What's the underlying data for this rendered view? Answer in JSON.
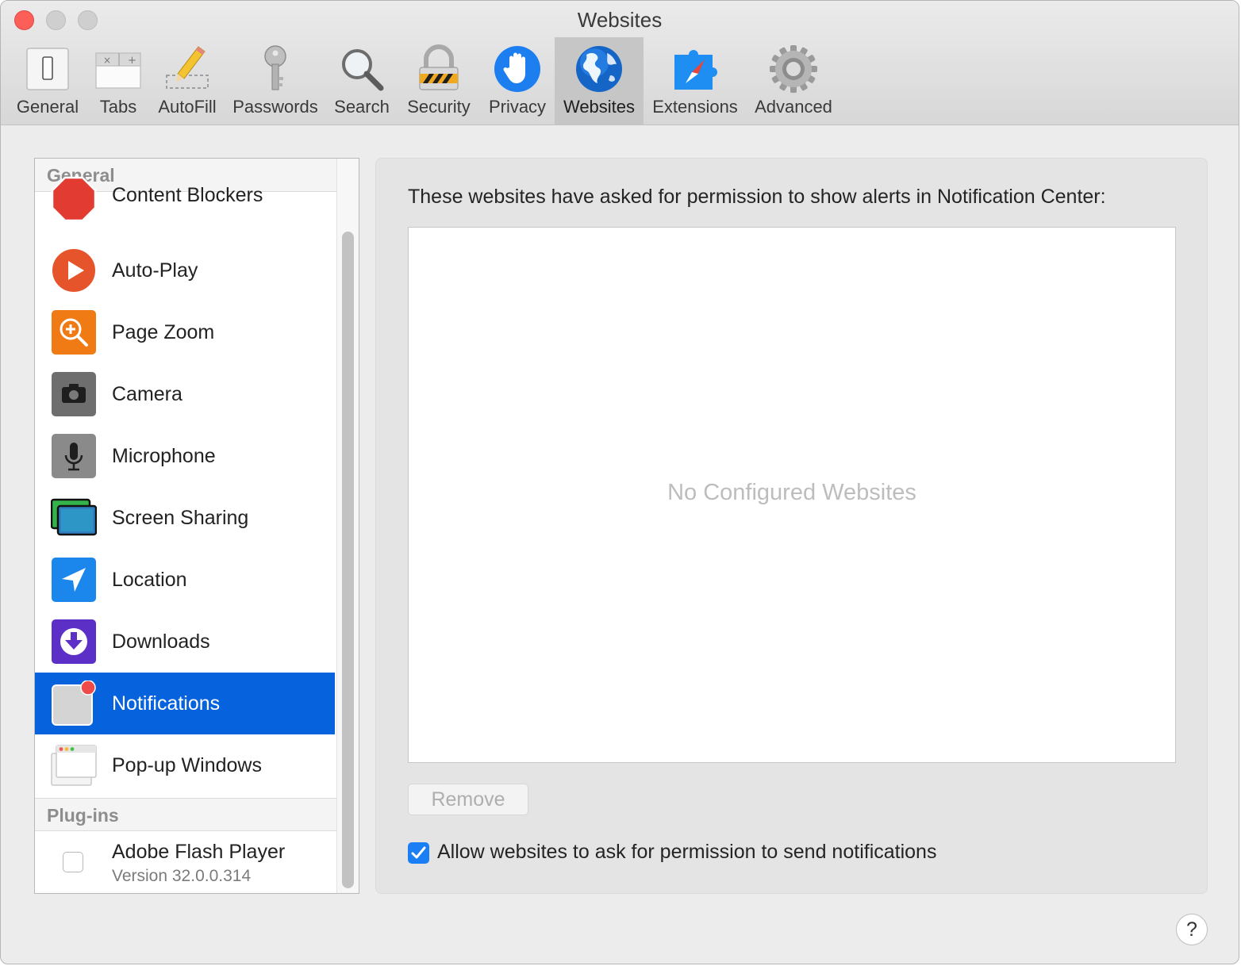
{
  "window": {
    "title": "Websites"
  },
  "toolbar": {
    "items": [
      {
        "label": "General",
        "icon": "general-switch-icon"
      },
      {
        "label": "Tabs",
        "icon": "tabs-icon"
      },
      {
        "label": "AutoFill",
        "icon": "autofill-pencil-icon"
      },
      {
        "label": "Passwords",
        "icon": "key-icon"
      },
      {
        "label": "Search",
        "icon": "magnifier-icon"
      },
      {
        "label": "Security",
        "icon": "padlock-icon"
      },
      {
        "label": "Privacy",
        "icon": "hand-icon"
      },
      {
        "label": "Websites",
        "icon": "globe-icon",
        "active": true
      },
      {
        "label": "Extensions",
        "icon": "puzzle-compass-icon"
      },
      {
        "label": "Advanced",
        "icon": "gear-icon"
      }
    ]
  },
  "sidebar": {
    "general_header": "General",
    "items": [
      {
        "label": "Content Blockers",
        "icon": "stop-sign-icon"
      },
      {
        "label": "Auto-Play",
        "icon": "play-icon"
      },
      {
        "label": "Page Zoom",
        "icon": "zoom-icon"
      },
      {
        "label": "Camera",
        "icon": "camera-icon"
      },
      {
        "label": "Microphone",
        "icon": "microphone-icon"
      },
      {
        "label": "Screen Sharing",
        "icon": "screen-sharing-icon"
      },
      {
        "label": "Location",
        "icon": "location-arrow-icon"
      },
      {
        "label": "Downloads",
        "icon": "download-icon"
      },
      {
        "label": "Notifications",
        "icon": "notification-badge-icon",
        "selected": true
      },
      {
        "label": "Pop-up Windows",
        "icon": "popup-window-icon"
      }
    ],
    "plugins_header": "Plug-ins",
    "plugins": [
      {
        "name": "Adobe Flash Player",
        "version": "Version 32.0.0.314",
        "checked": false
      }
    ]
  },
  "main": {
    "heading": "These websites have asked for permission to show alerts in Notification Center:",
    "empty_message": "No Configured Websites",
    "remove_label": "Remove",
    "allow_label": "Allow websites to ask for permission to send notifications",
    "allow_checked": true
  },
  "help_label": "?",
  "colors": {
    "selection": "#0763dd",
    "checkbox_accent": "#1a7ef5",
    "close_button": "#fc5f57"
  }
}
